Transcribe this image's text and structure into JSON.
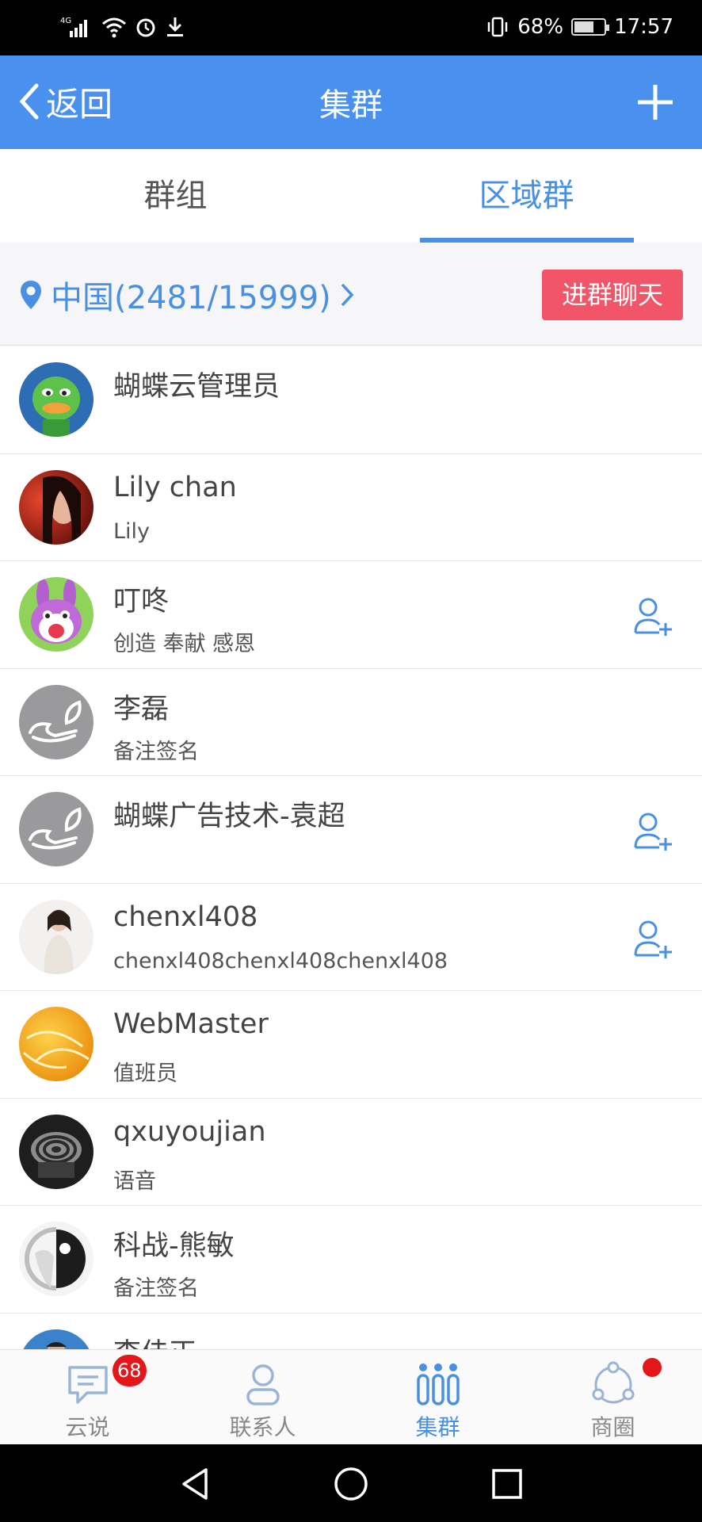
{
  "status_bar": {
    "network": "4G",
    "battery": "68%",
    "battery_level": 0.68,
    "time": "17:57"
  },
  "header": {
    "back_label": "返回",
    "title": "集群",
    "add_icon": "plus-icon"
  },
  "tabs": [
    {
      "label": "群组",
      "active": false
    },
    {
      "label": "区域群",
      "active": true
    }
  ],
  "region": {
    "label": "中国(2481/15999)",
    "join_button": "进群聊天",
    "icon": "location-pin-icon"
  },
  "members": [
    {
      "name": "蝴蝶云管理员",
      "subtitle": "",
      "avatar": "duck-avatar",
      "can_add": false
    },
    {
      "name": "Lily chan",
      "subtitle": "Lily",
      "avatar": "photo-avatar",
      "can_add": false
    },
    {
      "name": "叮咚",
      "subtitle": "创造 奉献 感恩",
      "avatar": "bunny-avatar",
      "can_add": true
    },
    {
      "name": "李磊",
      "subtitle": "备注签名",
      "avatar": "default-butterfly-avatar",
      "can_add": false
    },
    {
      "name": "蝴蝶广告技术-袁超",
      "subtitle": "",
      "avatar": "default-butterfly-avatar",
      "can_add": true
    },
    {
      "name": "chenxl408",
      "subtitle": "chenxl408chenxl408chenxl408",
      "avatar": "photo-avatar",
      "can_add": true
    },
    {
      "name": "WebMaster",
      "subtitle": "值班员",
      "avatar": "orange-avatar",
      "can_add": false
    },
    {
      "name": "qxuyoujian",
      "subtitle": "语音",
      "avatar": "spiral-avatar",
      "can_add": false
    },
    {
      "name": "科战-熊敏",
      "subtitle": "备注签名",
      "avatar": "bird-avatar",
      "can_add": false
    },
    {
      "name": "李佳正",
      "subtitle": "",
      "avatar": "photo-avatar",
      "can_add": true
    }
  ],
  "bottom_nav": [
    {
      "label": "云说",
      "icon": "chat-icon",
      "badge": "68",
      "active": false
    },
    {
      "label": "联系人",
      "icon": "contacts-icon",
      "badge": "",
      "active": false
    },
    {
      "label": "集群",
      "icon": "cluster-icon",
      "badge": "",
      "active": true
    },
    {
      "label": "商圈",
      "icon": "circle-icon",
      "badge": "",
      "dot": true,
      "active": false
    }
  ],
  "colors": {
    "primary": "#4a90ef",
    "accent_blue": "#4a90e2",
    "join_button": "#f25567",
    "badge_red": "#e5161a"
  }
}
